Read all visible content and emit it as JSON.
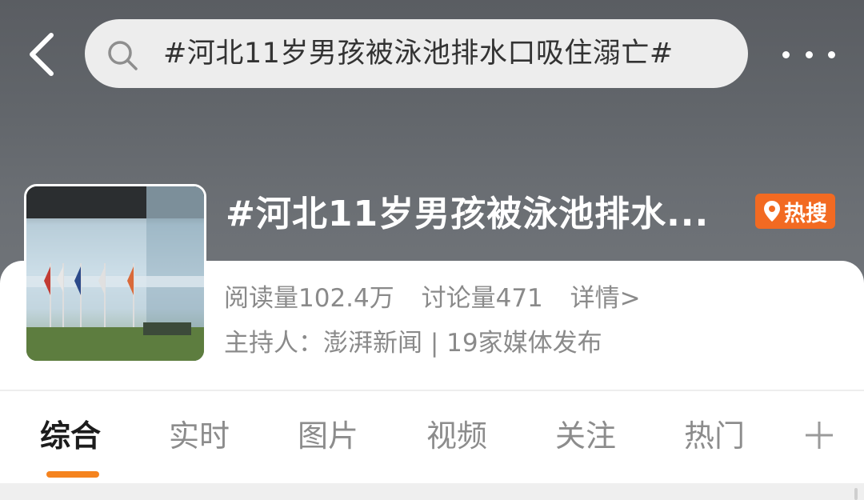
{
  "header": {
    "search_text": "#河北11岁男孩被泳池排水口吸住溺亡#"
  },
  "topic": {
    "title": "#河北11岁男孩被泳池排水...",
    "hot_badge_label": "热搜",
    "read_count": "阅读量102.4万",
    "discuss_count": "讨论量471",
    "details_link": "详情>",
    "host_line": "主持人：澎湃新闻 | 19家媒体发布"
  },
  "tabs": [
    {
      "label": "综合",
      "active": true
    },
    {
      "label": "实时",
      "active": false
    },
    {
      "label": "图片",
      "active": false
    },
    {
      "label": "视频",
      "active": false
    },
    {
      "label": "关注",
      "active": false
    },
    {
      "label": "热门",
      "active": false
    }
  ],
  "colors": {
    "accent_orange": "#f5831e",
    "hot_badge": "#f26a22",
    "header_bg": "#62666b"
  },
  "icons": [
    "back-arrow-icon",
    "search-icon",
    "more-icon",
    "location-pin-icon",
    "plus-icon"
  ]
}
